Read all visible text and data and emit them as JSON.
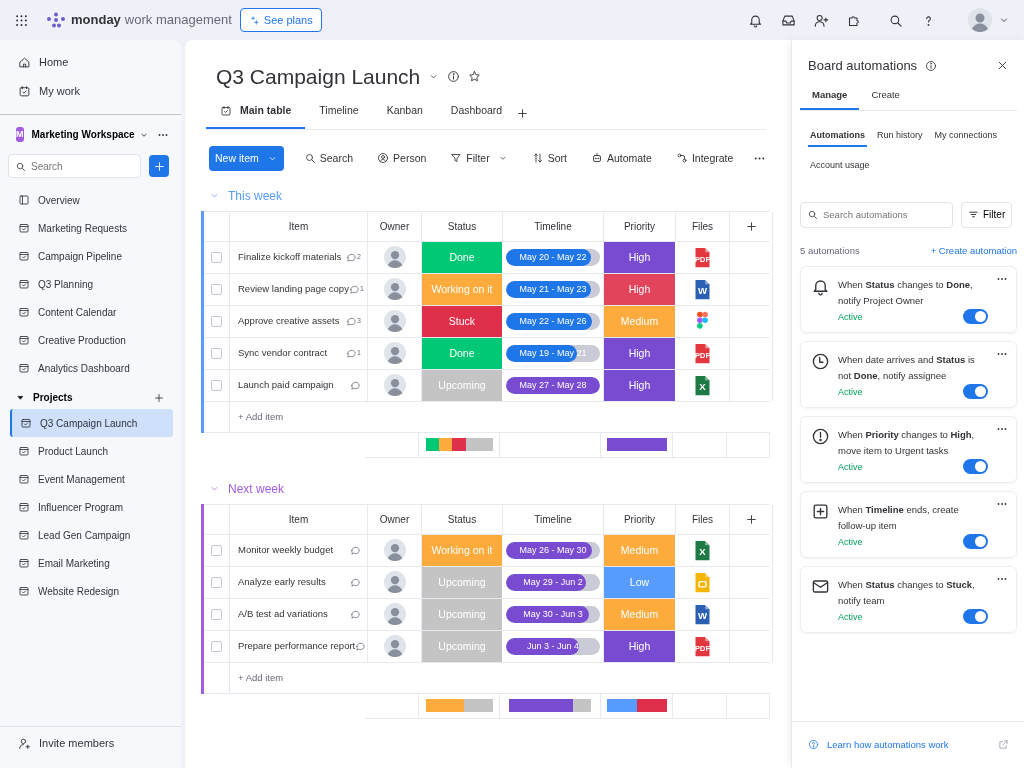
{
  "topbar": {
    "brand": "monday",
    "product": "work management",
    "plans_button": "See plans"
  },
  "sidebar": {
    "nav": [
      {
        "label": "Home",
        "kind": "home"
      },
      {
        "label": "My work",
        "kind": "mywork"
      }
    ],
    "workspace": {
      "badge": "M",
      "name": "Marketing Workspace"
    },
    "search": {
      "placeholder": "Search"
    },
    "boards": [
      {
        "label": "Overview",
        "kind": "overview"
      },
      {
        "label": "Marketing Requests",
        "kind": "board"
      },
      {
        "label": "Campaign Pipeline",
        "kind": "board"
      },
      {
        "label": "Q3 Planning",
        "kind": "board"
      },
      {
        "label": "Content Calendar",
        "kind": "board"
      },
      {
        "label": "Creative Production",
        "kind": "board"
      },
      {
        "label": "Analytics Dashboard",
        "kind": "board"
      }
    ],
    "folder": {
      "label": "Projects",
      "expanded": true,
      "children": [
        {
          "label": "Q3 Campaign Launch",
          "selected": true
        },
        {
          "label": "Product Launch",
          "selected": false
        },
        {
          "label": "Event Management",
          "selected": false
        },
        {
          "label": "Influencer Program",
          "selected": false
        },
        {
          "label": "Lead Gen Campaign",
          "selected": false
        },
        {
          "label": "Email Marketing",
          "selected": false
        },
        {
          "label": "Website Redesign",
          "selected": false
        }
      ]
    },
    "invite": "Invite members"
  },
  "board": {
    "title": "Q3 Campaign Launch",
    "views": [
      {
        "label": "Main table",
        "selected": true
      },
      {
        "label": "Timeline",
        "selected": false
      },
      {
        "label": "Kanban",
        "selected": false
      },
      {
        "label": "Dashboard",
        "selected": false
      }
    ],
    "new_item": "New item",
    "toolbar": [
      {
        "label": "Search",
        "kind": "search",
        "dropdown": false
      },
      {
        "label": "Person",
        "kind": "person",
        "dropdown": false
      },
      {
        "label": "Filter",
        "kind": "filter",
        "dropdown": true
      },
      {
        "label": "Sort",
        "kind": "sort",
        "dropdown": false
      },
      {
        "label": "Automate",
        "kind": "automate",
        "dropdown": false
      },
      {
        "label": "Integrate",
        "kind": "integrate",
        "dropdown": false
      }
    ],
    "groups": [
      {
        "title": "This week",
        "color": "#579bfc",
        "expanded": true,
        "add_item": "+ Add item",
        "columns": [
          "Item",
          "Owner",
          "Status",
          "Timeline",
          "Priority",
          "Files"
        ],
        "rows": [
          {
            "item": "Finalize kickoff materials",
            "checked": false,
            "comments": "2",
            "status": {
              "label": "Done",
              "color": "#00c875"
            },
            "timeline": {
              "label": "May 20 - May 22",
              "level": 0.9,
              "color": "#1f76e8"
            },
            "priority": {
              "label": "High",
              "color": "#784bd1"
            },
            "file": {
              "kind": "pdf",
              "label": "PDF"
            }
          },
          {
            "item": "Review landing page copy",
            "checked": false,
            "comments": "1",
            "status": {
              "label": "Working on it",
              "color": "#fdab3d"
            },
            "timeline": {
              "label": "May 21 - May 23",
              "level": 0.9,
              "color": "#1f76e8"
            },
            "priority": {
              "label": "High",
              "color": "#e2445c"
            },
            "file": {
              "kind": "word",
              "label": "W"
            }
          },
          {
            "item": "Approve creative assets",
            "checked": false,
            "comments": "3",
            "status": {
              "label": "Stuck",
              "color": "#df2f4a"
            },
            "timeline": {
              "label": "May 22 - May 26",
              "level": 0.92,
              "color": "#1f76e8"
            },
            "priority": {
              "label": "Medium",
              "color": "#fdab3d"
            },
            "file": {
              "kind": "figma"
            }
          },
          {
            "item": "Sync vendor contract",
            "checked": false,
            "comments": "1",
            "status": {
              "label": "Done",
              "color": "#00c875"
            },
            "timeline": {
              "label": "May 19 - May 21",
              "level": 0.75,
              "color": "#1f76e8"
            },
            "priority": {
              "label": "High",
              "color": "#784bd1"
            },
            "file": {
              "kind": "pdf",
              "label": "PDF"
            }
          },
          {
            "item": "Launch paid campaign",
            "checked": false,
            "status": {
              "label": "Upcoming",
              "color": "#c4c4c4"
            },
            "timeline": {
              "label": "May 27 - May 28",
              "level": 1,
              "color": "#784bd1"
            },
            "priority": {
              "label": "High",
              "color": "#784bd1"
            },
            "file": {
              "kind": "excel",
              "label": "X"
            }
          }
        ],
        "summary": {
          "status": [
            {
              "color": "#00c875",
              "kind": "narrow"
            },
            {
              "color": "#fdab3d",
              "kind": "narrow"
            },
            {
              "color": "#df2f4a",
              "kind": "narrow"
            },
            {
              "color": "#c4c4c4",
              "kind": "wide"
            }
          ],
          "priority": [
            {
              "color": "#784bd1",
              "kind": "narrow"
            }
          ]
        }
      },
      {
        "title": "Next week",
        "color": "#a25ddc",
        "expanded": true,
        "add_item": "+ Add item",
        "columns": [
          "Item",
          "Owner",
          "Status",
          "Timeline",
          "Priority",
          "Files"
        ],
        "rows": [
          {
            "item": "Monitor weekly budget",
            "checked": false,
            "status": {
              "label": "Working on it",
              "color": "#fdab3d"
            },
            "timeline": {
              "label": "May 26 - May 30",
              "level": 0.92,
              "color": "#784bd1"
            },
            "priority": {
              "label": "Medium",
              "color": "#fdab3d"
            },
            "file": {
              "kind": "excel",
              "label": "X"
            }
          },
          {
            "item": "Analyze early results",
            "checked": false,
            "status": {
              "label": "Upcoming",
              "color": "#c4c4c4"
            },
            "timeline": {
              "label": "May 29 - Jun 2",
              "level": 0.85,
              "color": "#784bd1"
            },
            "priority": {
              "label": "Low",
              "color": "#579bfc"
            },
            "file": {
              "kind": "slides"
            }
          },
          {
            "item": "A/B test ad variations",
            "checked": false,
            "status": {
              "label": "Upcoming",
              "color": "#c4c4c4"
            },
            "timeline": {
              "label": "May 30 - Jun 3",
              "level": 0.88,
              "color": "#784bd1"
            },
            "priority": {
              "label": "Medium",
              "color": "#fdab3d"
            },
            "file": {
              "kind": "word",
              "label": "W"
            }
          },
          {
            "item": "Prepare performance report",
            "checked": false,
            "status": {
              "label": "Upcoming",
              "color": "#c4c4c4"
            },
            "timeline": {
              "label": "Jun 3 - Jun 4",
              "level": 0.78,
              "color": "#784bd1"
            },
            "priority": {
              "label": "High",
              "color": "#784bd1"
            },
            "file": {
              "kind": "pdf",
              "label": "PDF"
            }
          }
        ],
        "summary": {
          "status": [
            {
              "color": "#fdab3d",
              "kind": "medium"
            },
            {
              "color": "#c4c4c4",
              "kind": "narrow"
            }
          ],
          "timeline": [
            {
              "color": "#784bd1",
              "kind": "long"
            },
            {
              "color": "#c4c4c4",
              "kind": "narrow"
            }
          ],
          "priority": [
            {
              "color": "#579bfc",
              "kind": "narrow"
            },
            {
              "color": "#df2f4a",
              "kind": "narrow"
            }
          ]
        }
      }
    ]
  },
  "automations_panel": {
    "title": "Board automations",
    "tabs": [
      {
        "label": "Manage",
        "selected": true
      },
      {
        "label": "Create",
        "selected": false
      }
    ],
    "subtabs": [
      {
        "label": "Automations",
        "selected": true
      },
      {
        "label": "Run history",
        "selected": false
      },
      {
        "label": "My connections",
        "selected": false
      },
      {
        "label": "Account usage",
        "selected": false
      }
    ],
    "search": {
      "placeholder": "Search automations"
    },
    "filter": "Filter",
    "count": "5 automations",
    "create": "+ Create automation",
    "items": [
      {
        "kind": "bell",
        "text": "When **Status** changes to **Done**, notify Project Owner",
        "status": "Active",
        "on": true
      },
      {
        "kind": "clock",
        "text": "When date arrives and **Status** is not **Done**, notify assignee",
        "status": "Active",
        "on": true
      },
      {
        "kind": "alert",
        "text": "When **Priority** changes to **High**, move item to Urgent tasks",
        "status": "Active",
        "on": true
      },
      {
        "kind": "plusbox",
        "text": "When **Timeline** ends, create follow-up item",
        "status": "Active",
        "on": true
      },
      {
        "kind": "mail",
        "text": "When **Status** changes to **Stuck**, notify team",
        "status": "Active",
        "on": true
      }
    ],
    "help": "Learn how automations work"
  }
}
